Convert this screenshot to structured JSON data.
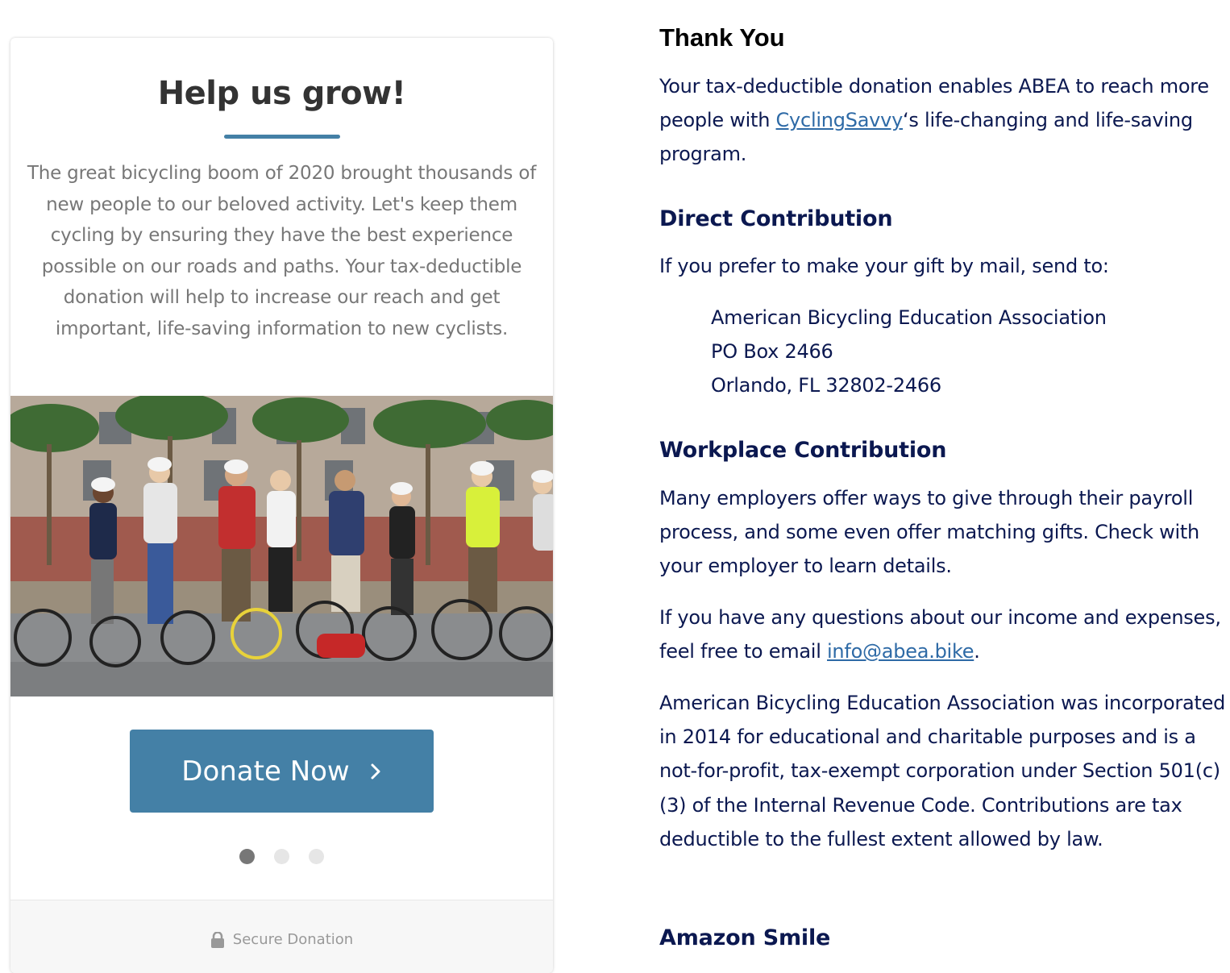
{
  "donation_card": {
    "title": "Help us grow!",
    "description": "The great bicycling boom of 2020 brought thousands of new people to our beloved activity. Let's keep them cycling by ensuring they have the best experience possible on our roads and paths. Your tax-deductible donation will help to increase our reach and get important, life-saving information to new cyclists.",
    "donate_button_label": "Donate Now",
    "carousel_dots": 3,
    "carousel_active_index": 0,
    "secure_label": "Secure Donation",
    "accent_color": "#4480a6"
  },
  "content": {
    "thank_you": {
      "heading": "Thank You",
      "text_before_link": "Your tax-deductible donation enables ABEA to reach more people with ",
      "link_text": "CyclingSavvy",
      "text_after_link": "‘s life-changing and life-saving program."
    },
    "direct": {
      "heading": "Direct Contribution",
      "intro": "If you prefer to make your gift by mail, send to:",
      "address_line1": "American Bicycling Education Association",
      "address_line2": "PO Box 2466",
      "address_line3": "Orlando, FL 32802-2466"
    },
    "workplace": {
      "heading": "Workplace Contribution",
      "text": "Many employers offer ways to give through their payroll process, and some even offer matching gifts. Check with your employer to learn details.",
      "questions_before_link": "If you have any questions about our income and expenses, feel free to email ",
      "email_link": "info@abea.bike",
      "questions_after_link": ".",
      "legal": "American Bicycling Education Association was incorporated in 2014 for educational and charitable purposes and is a not-for-profit, tax-exempt corporation under Section 501(c)(3) of the Internal Revenue Code. Contributions are tax deductible to the fullest extent allowed by law."
    },
    "amazon": {
      "heading": "Amazon Smile"
    },
    "text_color": "#0b1850",
    "link_color": "#2e6aa6"
  }
}
